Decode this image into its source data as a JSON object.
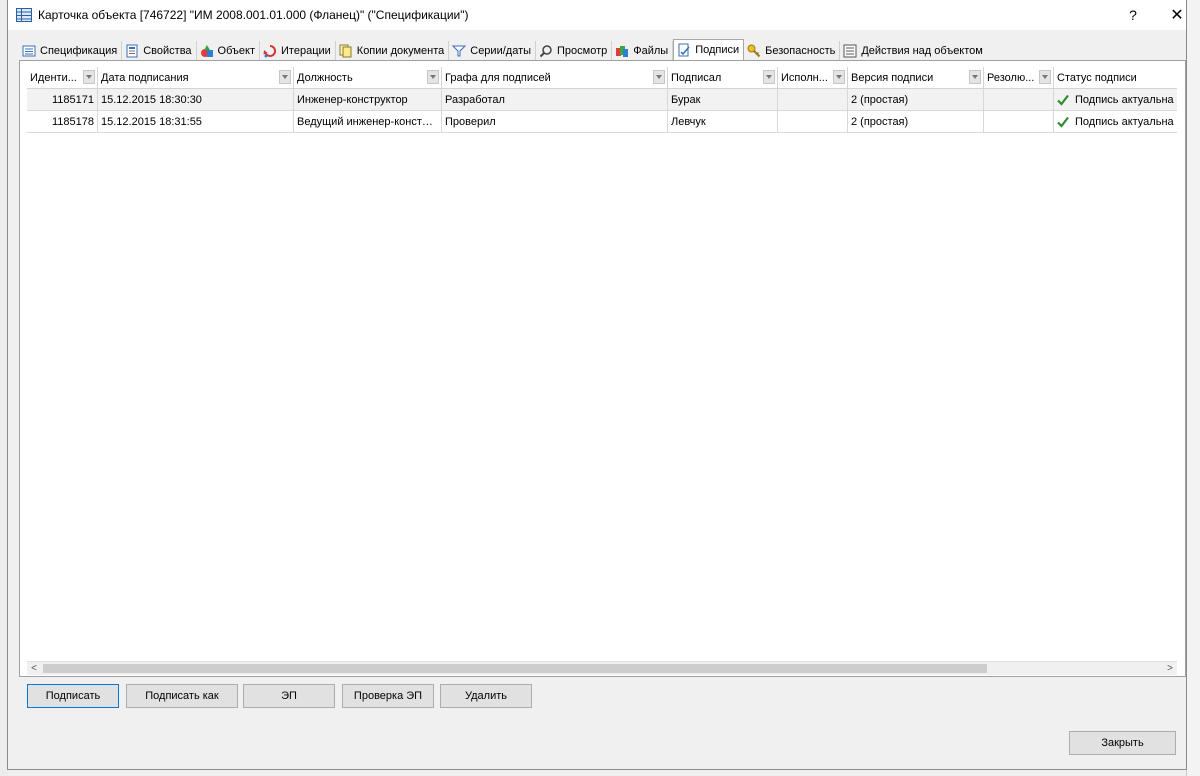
{
  "window": {
    "title": "Карточка объекта [746722] \"ИМ 2008.001.01.000 (Фланец)\" (\"Спецификации\")",
    "help_glyph": "?",
    "close_glyph": "✕"
  },
  "tabs": [
    {
      "label": "Спецификация",
      "icon": "list-icon"
    },
    {
      "label": "Свойства",
      "icon": "properties-icon"
    },
    {
      "label": "Объект",
      "icon": "shapes-icon"
    },
    {
      "label": "Итерации",
      "icon": "iterations-icon"
    },
    {
      "label": "Копии документа",
      "icon": "copies-icon"
    },
    {
      "label": "Серии/даты",
      "icon": "filter-icon"
    },
    {
      "label": "Просмотр",
      "icon": "magnifier-icon"
    },
    {
      "label": "Файлы",
      "icon": "files-icon"
    },
    {
      "label": "Подписи",
      "icon": "signature-icon",
      "active": true
    },
    {
      "label": "Безопасность",
      "icon": "key-icon"
    },
    {
      "label": "Действия над объектом",
      "icon": "actions-icon"
    }
  ],
  "columns": [
    "Иденти...",
    "Дата подписания",
    "Должность",
    "Графа для подписей",
    "Подписал",
    "Исполн...",
    "Версия подписи",
    "Резолю...",
    "Статус подписи"
  ],
  "rows": [
    {
      "id": "1185171",
      "date": "15.12.2015 18:30:30",
      "position": "Инженер-конструктор",
      "field": "Разработал",
      "signer": "Бурак",
      "executor": "",
      "version": "2 (простая)",
      "resolution": "",
      "status": "Подпись актуальна"
    },
    {
      "id": "1185178",
      "date": "15.12.2015 18:31:55",
      "position": "Ведущий  инженер-констру...",
      "field": "Проверил",
      "signer": "Левчук",
      "executor": "",
      "version": "2 (простая)",
      "resolution": "",
      "status": "Подпись актуальна"
    }
  ],
  "buttons": {
    "sign": "Подписать",
    "sign_as": "Подписать как",
    "ep": "ЭП",
    "check_ep": "Проверка ЭП",
    "delete": "Удалить",
    "close": "Закрыть"
  },
  "scroll": {
    "left_glyph": "<",
    "right_glyph": ">"
  },
  "colors": {
    "status_check": "#2e8b2e",
    "selection": "#f2f2f2",
    "default_button_border": "#0078d7"
  }
}
